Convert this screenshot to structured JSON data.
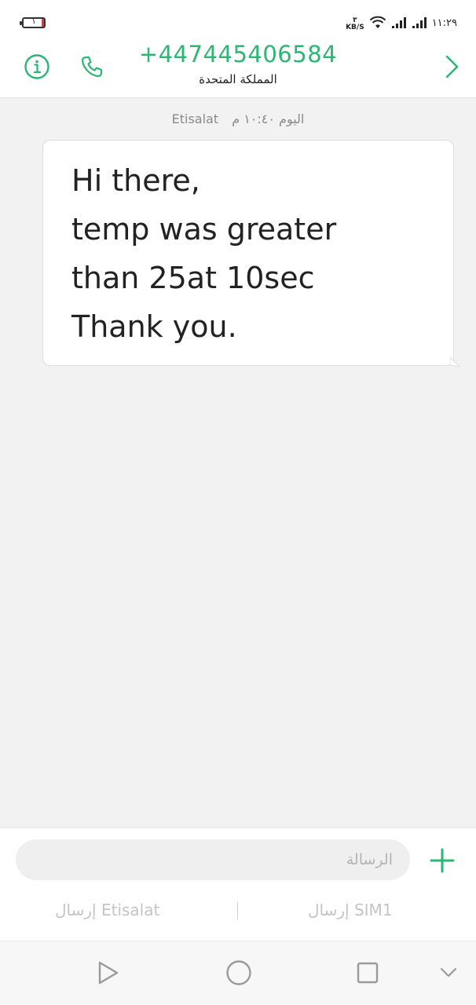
{
  "status_bar": {
    "battery_level": "١",
    "net_speed_value": "٣",
    "net_speed_unit": "KB/S",
    "time": "١١:٢٩"
  },
  "header": {
    "contact_number": "+447445406584",
    "contact_country": "المملكة المتحدة"
  },
  "conversation": {
    "sender": "Etisalat",
    "timestamp": "اليوم ١٠:٤٠ م",
    "message": "Hi there,\ntemp was greater\nthan 25at 10sec\nThank you."
  },
  "compose": {
    "placeholder": "الرسالة",
    "value": "",
    "send_etisalat_label": "إرسال Etisalat",
    "send_sim_label": "إرسال SIM1"
  },
  "colors": {
    "accent": "#2bb673",
    "bubble_background": "#ffffff",
    "conversation_background": "#f2f2f2"
  }
}
